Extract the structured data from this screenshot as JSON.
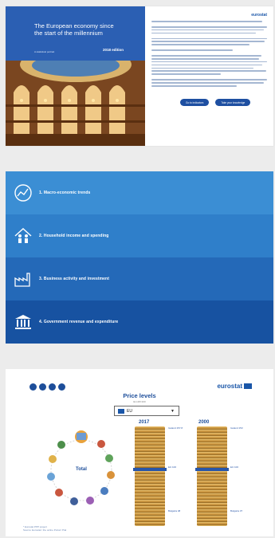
{
  "hero": {
    "title": "The European economy since the start of the millennium",
    "subtitle": "A statistical portrait",
    "edition": "2018 edition",
    "logo": "eurostat",
    "buttons": [
      "Go to indicators",
      "Take your knowledge"
    ]
  },
  "menu": {
    "items": [
      {
        "label": "1. Macro-economic trends",
        "icon": "chart-icon",
        "color": "#3b8ed4"
      },
      {
        "label": "2. Household income and spending",
        "icon": "household-icon",
        "color": "#2f7fca"
      },
      {
        "label": "3. Business activity and investment",
        "icon": "factory-icon",
        "color": "#2469b8"
      },
      {
        "label": "4. Government revenue and expenditure",
        "icon": "government-icon",
        "color": "#1752a1"
      }
    ]
  },
  "prices": {
    "share_icons": [
      "facebook-icon",
      "twitter-icon",
      "linkedin-icon",
      "email-icon"
    ],
    "logo": "eurostat",
    "title": "Price levels",
    "subtitle": "EU-28=100",
    "select_value": "EU",
    "total_label": "Total",
    "year_left": "2017",
    "year_right": "2000",
    "ann_left_top": "Iceland 157.8",
    "ann_left_mid": "EU 100",
    "ann_left_bot": "Bulgaria 48",
    "ann_right_top": "Iceland 153",
    "ann_right_mid": "EU 100",
    "ann_right_bot": "Bulgaria 37",
    "footnote_1": "* Eurostat PPP project",
    "footnote_2": "Source: Eurostat / the online Portal / Ptal"
  }
}
